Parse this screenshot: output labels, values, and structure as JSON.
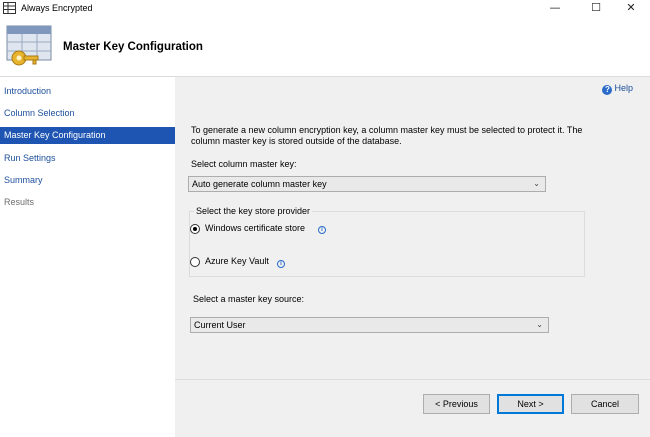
{
  "window": {
    "title": "Always Encrypted",
    "controls": {
      "minimize": "—",
      "maximize": "☐",
      "close": "✕"
    }
  },
  "header": {
    "title": "Master Key Configuration"
  },
  "sidebar": {
    "items": [
      {
        "label": "Introduction",
        "state": "link"
      },
      {
        "label": "Column Selection",
        "state": "link"
      },
      {
        "label": "Master Key Configuration",
        "state": "active"
      },
      {
        "label": "Run Settings",
        "state": "link"
      },
      {
        "label": "Summary",
        "state": "link"
      },
      {
        "label": "Results",
        "state": "disabled"
      }
    ]
  },
  "main": {
    "help_label": "Help",
    "description": "To generate a new column encryption key, a column master key must be selected to protect it.  The column master key is stored outside of the database.",
    "master_key_label": "Select column master key:",
    "master_key_value": "Auto generate column master key",
    "provider_group_title": "Select the key store provider",
    "providers": [
      {
        "label": "Windows certificate store",
        "selected": true
      },
      {
        "label": "Azure Key Vault",
        "selected": false
      }
    ],
    "source_label": "Select a master key source:",
    "source_value": "Current User"
  },
  "footer": {
    "previous": "< Previous",
    "next": "Next >",
    "cancel": "Cancel"
  },
  "colors": {
    "accent": "#1e55b3",
    "link": "#1c4f9c",
    "panel_bg": "#f0f0f0"
  }
}
